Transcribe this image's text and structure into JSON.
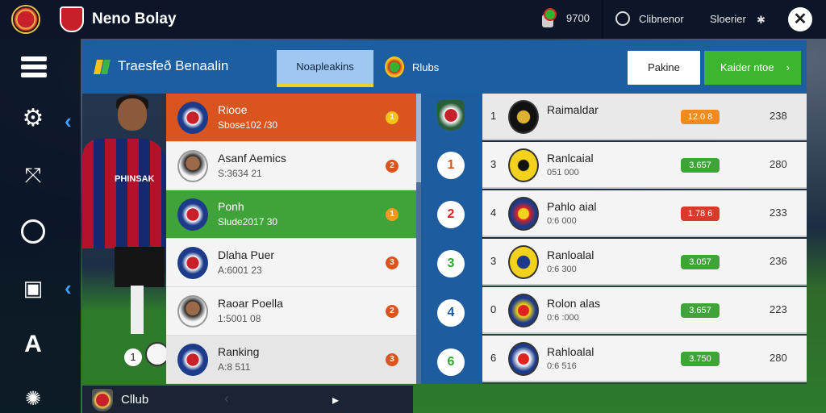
{
  "header": {
    "app_title": "Neno Bolay",
    "coins": "9700",
    "user_label": "Clibnenor",
    "settings_label": "Sloerier",
    "close_glyph": "✕"
  },
  "sidebar": {
    "icons": [
      "menu-icon",
      "gear-icon",
      "tactics-icon",
      "ring-icon",
      "club-doc-icon",
      "text-a-icon",
      "spinner-icon"
    ],
    "a_glyph": "A"
  },
  "toolbar": {
    "title": "Traesfeð Benaalin",
    "active_tab": "Noapleakins",
    "tab2": "Rlubs",
    "ranking_button": "Pakine",
    "green_button": "Kaider ntoe",
    "green_button_chevron": "›"
  },
  "player": {
    "shirt_text": "PHINSAK",
    "number": "1"
  },
  "list_left": [
    {
      "name": "Riooe",
      "sub": "Sbose102 /30",
      "badge": "1",
      "style": "orange",
      "badge_color": "#f3c21c",
      "avatar": "crest"
    },
    {
      "name": "Asanf Aemics",
      "sub": "S:3634 21",
      "badge": "2",
      "style": "white",
      "badge_color": "#d9541e",
      "avatar": "face"
    },
    {
      "name": "Ponh",
      "sub": "Slude2017 30",
      "badge": "1",
      "style": "green",
      "badge_color": "#f39a1c",
      "avatar": "crest"
    },
    {
      "name": "Dlaha Puer",
      "sub": "A:6001 23",
      "badge": "3",
      "style": "white",
      "badge_color": "#d9541e",
      "avatar": "crest"
    },
    {
      "name": "Raoar Poella",
      "sub": "1:5001 08",
      "badge": "2",
      "style": "white",
      "badge_color": "#d9541e",
      "avatar": "face"
    },
    {
      "name": "Ranking",
      "sub": "A:8 511",
      "badge": "3",
      "style": "grey",
      "badge_color": "#d9541e",
      "avatar": "crest"
    }
  ],
  "mid_badges": [
    {
      "label": "1",
      "color": "#d9541e"
    },
    {
      "label": "2",
      "color": "#d22"
    },
    {
      "label": "3",
      "color": "#2fa52f"
    },
    {
      "label": "4",
      "color": "#1e5ca0"
    },
    {
      "label": "6",
      "color": "#2fa52f"
    }
  ],
  "table_right": [
    {
      "rank": "1",
      "team": "Raimaldar",
      "sub": "",
      "pill": "12.0 8",
      "pill_color": "#f08a1c",
      "points": "238"
    },
    {
      "rank": "3",
      "team": "Ranlcaial",
      "sub": "051 000",
      "pill": "3.657",
      "pill_color": "#3fa33a",
      "points": "280"
    },
    {
      "rank": "4",
      "team": "Pahlo aial",
      "sub": "0:6 000",
      "pill": "1.78 6",
      "pill_color": "#d93a2a",
      "points": "233"
    },
    {
      "rank": "3",
      "team": "Ranloalal",
      "sub": "0:6 300",
      "pill": "3.057",
      "pill_color": "#3fa33a",
      "points": "236"
    },
    {
      "rank": "0",
      "team": "Rolon alas",
      "sub": "0:6 :000",
      "pill": "3.657",
      "pill_color": "#3fa33a",
      "points": "223"
    },
    {
      "rank": "6",
      "team": "Rahloalal",
      "sub": "0:6 516",
      "pill": "3.750",
      "pill_color": "#3fa33a",
      "points": "280"
    }
  ],
  "bottom": {
    "club_label": "Cllub",
    "prev_glyph": "‹",
    "next_glyph": "▸"
  }
}
